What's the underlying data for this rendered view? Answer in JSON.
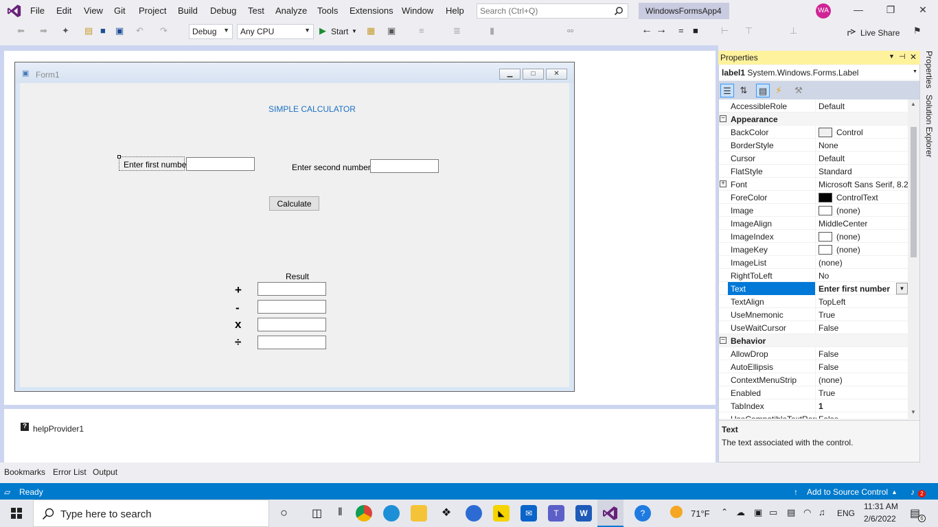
{
  "menubar": {
    "items": [
      "File",
      "Edit",
      "View",
      "Git",
      "Project",
      "Build",
      "Debug",
      "Test",
      "Analyze",
      "Tools",
      "Extensions",
      "Window",
      "Help"
    ],
    "search_placeholder": "Search (Ctrl+Q)",
    "project_name": "WindowsFormsApp4",
    "avatar_initials": "WA"
  },
  "toolbar": {
    "config": "Debug",
    "platform": "Any CPU",
    "start_label": "Start",
    "live_share": "Live Share"
  },
  "form": {
    "title": "Form1",
    "heading": "SIMPLE CALCULATOR",
    "first_label": "Enter first number",
    "second_label": "Enter second number",
    "calc_button": "Calculate",
    "result_label": "Result",
    "ops": [
      "+",
      "-",
      "x",
      "÷"
    ],
    "first_value": "",
    "second_value": ""
  },
  "tray": {
    "component": "helpProvider1"
  },
  "properties": {
    "title": "Properties",
    "object_name": "label1",
    "object_type": "System.Windows.Forms.Label",
    "rows": [
      {
        "name": "AccessibleRole",
        "value": "Default"
      },
      {
        "name": "Appearance",
        "category": true
      },
      {
        "name": "BackColor",
        "value": "Control",
        "swatch": "#f0f0f0"
      },
      {
        "name": "BorderStyle",
        "value": "None"
      },
      {
        "name": "Cursor",
        "value": "Default"
      },
      {
        "name": "FlatStyle",
        "value": "Standard"
      },
      {
        "name": "Font",
        "value": "Microsoft Sans Serif, 8.25",
        "expand": true
      },
      {
        "name": "ForeColor",
        "value": "ControlText",
        "swatch": "#000000"
      },
      {
        "name": "Image",
        "value": "(none)",
        "swatch": "#ffffff"
      },
      {
        "name": "ImageAlign",
        "value": "MiddleCenter"
      },
      {
        "name": "ImageIndex",
        "value": "(none)",
        "swatch": "#ffffff"
      },
      {
        "name": "ImageKey",
        "value": "(none)",
        "swatch": "#ffffff"
      },
      {
        "name": "ImageList",
        "value": "(none)"
      },
      {
        "name": "RightToLeft",
        "value": "No"
      },
      {
        "name": "Text",
        "value": "Enter first number",
        "selected": true
      },
      {
        "name": "TextAlign",
        "value": "TopLeft"
      },
      {
        "name": "UseMnemonic",
        "value": "True"
      },
      {
        "name": "UseWaitCursor",
        "value": "False"
      },
      {
        "name": "Behavior",
        "category": true
      },
      {
        "name": "AllowDrop",
        "value": "False"
      },
      {
        "name": "AutoEllipsis",
        "value": "False"
      },
      {
        "name": "ContextMenuStrip",
        "value": "(none)"
      },
      {
        "name": "Enabled",
        "value": "True"
      },
      {
        "name": "TabIndex",
        "value": "1",
        "bold": true
      },
      {
        "name": "UseCompatibleTextRen",
        "value": "False"
      }
    ],
    "desc_title": "Text",
    "desc_body": "The text associated with the control."
  },
  "side_tabs": [
    "Properties",
    "Solution Explorer"
  ],
  "bottom_tabs": [
    "Bookmarks",
    "Error List",
    "Output"
  ],
  "status": {
    "ready": "Ready",
    "source_control": "Add to Source Control",
    "notifications": "2"
  },
  "taskbar": {
    "search_placeholder": "Type here to search",
    "weather": "71°F",
    "lang": "ENG",
    "time": "11:31 AM",
    "date": "2/6/2022",
    "notif_count": "6"
  },
  "colors": {
    "accent": "#007acc",
    "selection": "#0078d7",
    "properties_header": "#fff29d",
    "vs_purple": "#68217a",
    "heading_blue": "#1a6fc4"
  }
}
